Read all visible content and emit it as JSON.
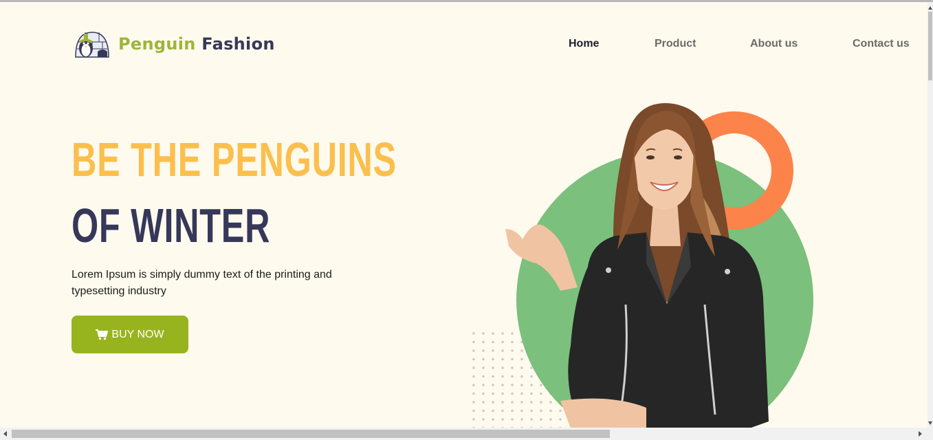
{
  "header": {
    "brand_word1": "Penguin",
    "brand_word2": "Fashion",
    "logo_icon": "penguin-igloo-icon",
    "nav": [
      {
        "label": "Home",
        "active": true
      },
      {
        "label": "Product",
        "active": false
      },
      {
        "label": "About us",
        "active": false
      },
      {
        "label": "Contact us",
        "active": false
      }
    ]
  },
  "hero": {
    "headline_line1": "BE THE PENGUINS",
    "headline_line2": "OF WINTER",
    "description": "Lorem Ipsum is simply dummy text of the printing and typesetting industry",
    "cta_label": "BUY NOW",
    "cta_icon": "shopping-cart-icon",
    "model_image": "smiling woman in black leather jacket"
  },
  "colors": {
    "background": "#fffaee",
    "brand_green": "#9cb637",
    "navy": "#36385a",
    "headline_yellow": "#fbbf4d",
    "cta_green": "#97b41e",
    "circle_green": "#7bc07d",
    "ring_orange": "#fc834a"
  }
}
